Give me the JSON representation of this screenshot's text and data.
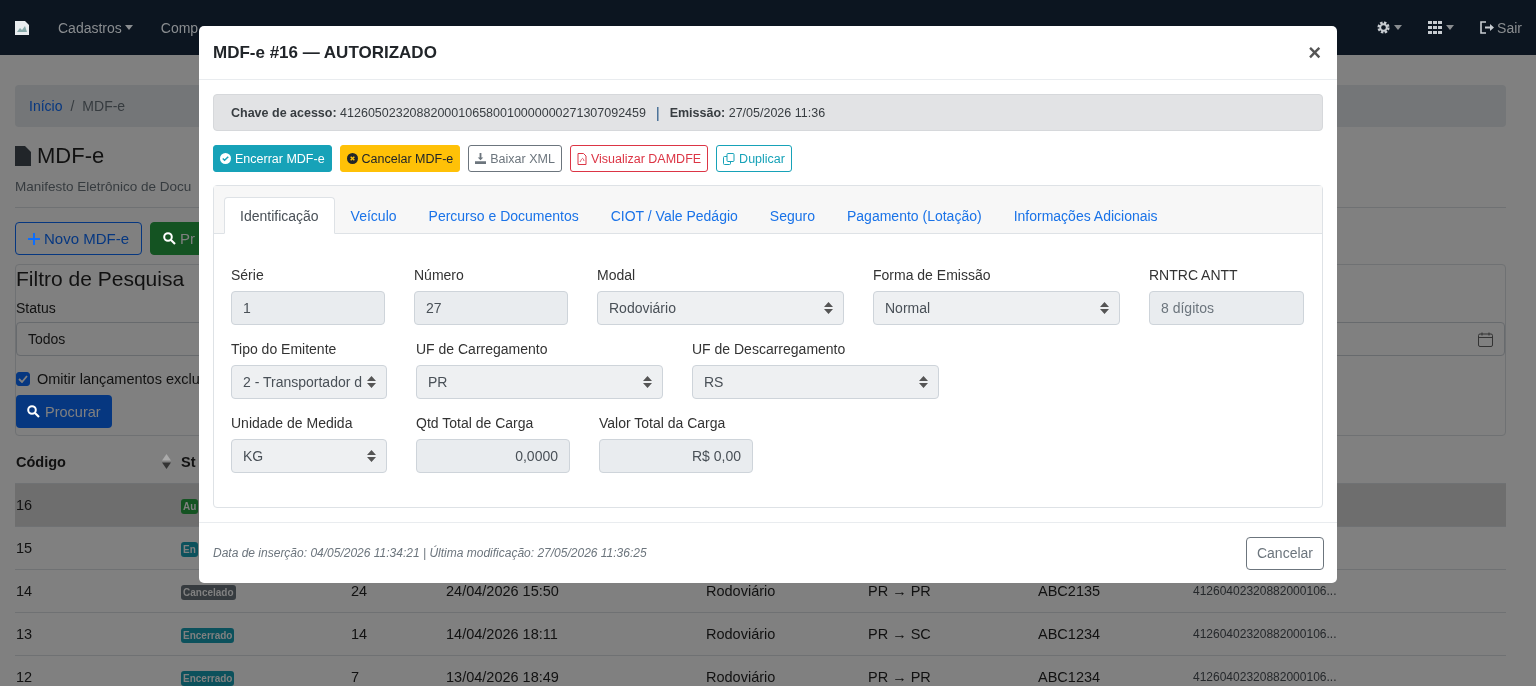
{
  "navbar": {
    "menu": [
      {
        "label": "Cadastros",
        "dropdown": true
      },
      {
        "label": "Comp",
        "dropdown": false
      }
    ],
    "icons": [
      {
        "kind": "gear",
        "dropdown": true
      },
      {
        "kind": "grid",
        "dropdown": true
      }
    ],
    "logout": "Sair"
  },
  "page": {
    "breadcrumb": [
      {
        "label": "Início",
        "link": true
      },
      {
        "label": "MDF-e",
        "link": false
      }
    ],
    "breadcrumb_separator": "/",
    "title": "MDF-e",
    "subtitle": "Manifesto Eletrônico de Docu",
    "actions": [
      {
        "label": "Novo MDF-e",
        "kind": "outline"
      },
      {
        "label": "Pr",
        "kind": "success"
      }
    ],
    "filter": {
      "title": "Filtro de Pesquisa",
      "status_label": "Status",
      "status_value": "Todos",
      "omit_label": "Omitir lançamentos exclu",
      "omit_checked": true,
      "search_button": "Procurar"
    },
    "table": {
      "columns": [
        "Código",
        "St"
      ],
      "rows": [
        {
          "code": "16",
          "status": "Au",
          "color": "#145322",
          "selected": true
        },
        {
          "code": "15",
          "status": "En",
          "color": "#0c515c",
          "selected": false
        },
        {
          "code": "14",
          "status": "Cancelado",
          "color": "#363b3f",
          "selected": false,
          "number": "24",
          "date": "24/04/2026 15:50",
          "modal": "Rodoviário",
          "route": "PR → PR",
          "plate": "ABC2135",
          "key": "41260402320882000106..."
        },
        {
          "code": "13",
          "status": "Encerrado",
          "color": "#0c515c",
          "selected": false,
          "number": "14",
          "date": "14/04/2026 18:11",
          "modal": "Rodoviário",
          "route": "PR → SC",
          "plate": "ABC1234",
          "key": "41260402320882000106..."
        },
        {
          "code": "12",
          "status": "Encerrado",
          "color": "#0c515c",
          "selected": false,
          "number": "7",
          "date": "13/04/2026 18:49",
          "modal": "Rodoviário",
          "route": "PR → PR",
          "plate": "ABC1234",
          "key": "41260402320882000106..."
        }
      ]
    }
  },
  "modal": {
    "title": "MDF-e #16 — AUTORIZADO",
    "close": "×",
    "info": [
      {
        "label": "Chave de acesso:",
        "value": "41260502320882000106580010000000271307092459"
      },
      {
        "label": "Emissão:",
        "value": "27/05/2026 11:36"
      }
    ],
    "info_separator": "|",
    "buttons": [
      {
        "label": "Encerrar MDF-e",
        "kind": "info"
      },
      {
        "label": "Cancelar MDF-e",
        "kind": "warning"
      },
      {
        "label": "Baixar XML",
        "kind": "secondary"
      },
      {
        "label": "Visualizar DAMDFE",
        "kind": "danger"
      },
      {
        "label": "Duplicar",
        "kind": "outline-info"
      }
    ],
    "tabs": [
      {
        "label": "Identificação",
        "selected": true
      },
      {
        "label": "Veículo",
        "selected": false
      },
      {
        "label": "Percurso e Documentos",
        "selected": false
      },
      {
        "label": "CIOT / Vale Pedágio",
        "selected": false
      },
      {
        "label": "Seguro",
        "selected": false
      },
      {
        "label": "Pagamento (Lotação)",
        "selected": false
      },
      {
        "label": "Informações Adicionais",
        "selected": false
      }
    ],
    "form_rows": [
      [
        {
          "label": "Série",
          "kind": "input",
          "value": "1"
        },
        {
          "label": "Número",
          "kind": "input",
          "value": "27"
        },
        {
          "label": "Modal",
          "kind": "select",
          "value": "Rodoviário"
        },
        {
          "label": "Forma de Emissão",
          "kind": "select",
          "value": "Normal"
        },
        {
          "label": "RNTRC ANTT",
          "kind": "input",
          "placeholder": "8 dígitos"
        }
      ],
      [
        {
          "label": "Tipo do Emitente",
          "kind": "select",
          "value": "2 - Transportador d"
        },
        {
          "label": "UF de Carregamento",
          "kind": "select",
          "value": "PR"
        },
        {
          "label": "UF de Descarregamento",
          "kind": "select",
          "value": "RS"
        }
      ],
      [
        {
          "label": "Unidade de Medida",
          "kind": "select",
          "value": "KG"
        },
        {
          "label": "Qtd Total de Carga",
          "kind": "input",
          "value": "0,0000"
        },
        {
          "label": "Valor Total da Carga",
          "kind": "input",
          "value": "R$ 0,00"
        }
      ]
    ],
    "footer_text": "Data de inserção: 04/05/2026 11:34:21 | Última modificação: 27/05/2026 11:36:25",
    "cancel": "Cancelar"
  }
}
